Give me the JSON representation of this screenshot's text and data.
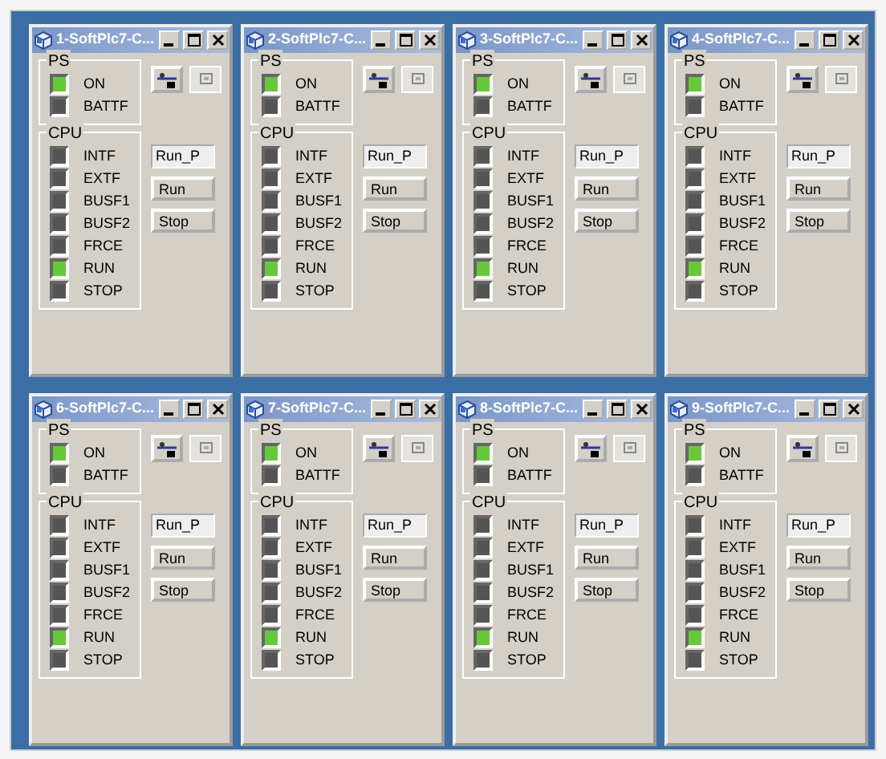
{
  "windows": [
    {
      "title": "1-SoftPlc7-C...",
      "ps": {
        "label": "PS",
        "leds": [
          {
            "label": "ON",
            "on": true
          },
          {
            "label": "BATTF",
            "on": false
          }
        ]
      },
      "cpu": {
        "label": "CPU",
        "leds": [
          {
            "label": "INTF",
            "on": false
          },
          {
            "label": "EXTF",
            "on": false
          },
          {
            "label": "BUSF1",
            "on": false
          },
          {
            "label": "BUSF2",
            "on": false
          },
          {
            "label": "FRCE",
            "on": false
          },
          {
            "label": "RUN",
            "on": true
          },
          {
            "label": "STOP",
            "on": false
          }
        ]
      },
      "mode": "Run_P",
      "buttons": [
        "Run",
        "Stop"
      ]
    },
    {
      "title": "2-SoftPlc7-C...",
      "ps": {
        "label": "PS",
        "leds": [
          {
            "label": "ON",
            "on": true
          },
          {
            "label": "BATTF",
            "on": false
          }
        ]
      },
      "cpu": {
        "label": "CPU",
        "leds": [
          {
            "label": "INTF",
            "on": false
          },
          {
            "label": "EXTF",
            "on": false
          },
          {
            "label": "BUSF1",
            "on": false
          },
          {
            "label": "BUSF2",
            "on": false
          },
          {
            "label": "FRCE",
            "on": false
          },
          {
            "label": "RUN",
            "on": true
          },
          {
            "label": "STOP",
            "on": false
          }
        ]
      },
      "mode": "Run_P",
      "buttons": [
        "Run",
        "Stop"
      ]
    },
    {
      "title": "3-SoftPlc7-C...",
      "ps": {
        "label": "PS",
        "leds": [
          {
            "label": "ON",
            "on": true
          },
          {
            "label": "BATTF",
            "on": false
          }
        ]
      },
      "cpu": {
        "label": "CPU",
        "leds": [
          {
            "label": "INTF",
            "on": false
          },
          {
            "label": "EXTF",
            "on": false
          },
          {
            "label": "BUSF1",
            "on": false
          },
          {
            "label": "BUSF2",
            "on": false
          },
          {
            "label": "FRCE",
            "on": false
          },
          {
            "label": "RUN",
            "on": true
          },
          {
            "label": "STOP",
            "on": false
          }
        ]
      },
      "mode": "Run_P",
      "buttons": [
        "Run",
        "Stop"
      ]
    },
    {
      "title": "4-SoftPlc7-C...",
      "ps": {
        "label": "PS",
        "leds": [
          {
            "label": "ON",
            "on": true
          },
          {
            "label": "BATTF",
            "on": false
          }
        ]
      },
      "cpu": {
        "label": "CPU",
        "leds": [
          {
            "label": "INTF",
            "on": false
          },
          {
            "label": "EXTF",
            "on": false
          },
          {
            "label": "BUSF1",
            "on": false
          },
          {
            "label": "BUSF2",
            "on": false
          },
          {
            "label": "FRCE",
            "on": false
          },
          {
            "label": "RUN",
            "on": true
          },
          {
            "label": "STOP",
            "on": false
          }
        ]
      },
      "mode": "Run_P",
      "buttons": [
        "Run",
        "Stop"
      ]
    },
    {
      "title": "6-SoftPlc7-C...",
      "ps": {
        "label": "PS",
        "leds": [
          {
            "label": "ON",
            "on": true
          },
          {
            "label": "BATTF",
            "on": false
          }
        ]
      },
      "cpu": {
        "label": "CPU",
        "leds": [
          {
            "label": "INTF",
            "on": false
          },
          {
            "label": "EXTF",
            "on": false
          },
          {
            "label": "BUSF1",
            "on": false
          },
          {
            "label": "BUSF2",
            "on": false
          },
          {
            "label": "FRCE",
            "on": false
          },
          {
            "label": "RUN",
            "on": true
          },
          {
            "label": "STOP",
            "on": false
          }
        ]
      },
      "mode": "Run_P",
      "buttons": [
        "Run",
        "Stop"
      ]
    },
    {
      "title": "7-SoftPlc7-C...",
      "ps": {
        "label": "PS",
        "leds": [
          {
            "label": "ON",
            "on": true
          },
          {
            "label": "BATTF",
            "on": false
          }
        ]
      },
      "cpu": {
        "label": "CPU",
        "leds": [
          {
            "label": "INTF",
            "on": false
          },
          {
            "label": "EXTF",
            "on": false
          },
          {
            "label": "BUSF1",
            "on": false
          },
          {
            "label": "BUSF2",
            "on": false
          },
          {
            "label": "FRCE",
            "on": false
          },
          {
            "label": "RUN",
            "on": true
          },
          {
            "label": "STOP",
            "on": false
          }
        ]
      },
      "mode": "Run_P",
      "buttons": [
        "Run",
        "Stop"
      ]
    },
    {
      "title": "8-SoftPlc7-C...",
      "ps": {
        "label": "PS",
        "leds": [
          {
            "label": "ON",
            "on": true
          },
          {
            "label": "BATTF",
            "on": false
          }
        ]
      },
      "cpu": {
        "label": "CPU",
        "leds": [
          {
            "label": "INTF",
            "on": false
          },
          {
            "label": "EXTF",
            "on": false
          },
          {
            "label": "BUSF1",
            "on": false
          },
          {
            "label": "BUSF2",
            "on": false
          },
          {
            "label": "FRCE",
            "on": false
          },
          {
            "label": "RUN",
            "on": true
          },
          {
            "label": "STOP",
            "on": false
          }
        ]
      },
      "mode": "Run_P",
      "buttons": [
        "Run",
        "Stop"
      ]
    },
    {
      "title": "9-SoftPlc7-C...",
      "ps": {
        "label": "PS",
        "leds": [
          {
            "label": "ON",
            "on": true
          },
          {
            "label": "BATTF",
            "on": false
          }
        ]
      },
      "cpu": {
        "label": "CPU",
        "leds": [
          {
            "label": "INTF",
            "on": false
          },
          {
            "label": "EXTF",
            "on": false
          },
          {
            "label": "BUSF1",
            "on": false
          },
          {
            "label": "BUSF2",
            "on": false
          },
          {
            "label": "FRCE",
            "on": false
          },
          {
            "label": "RUN",
            "on": true
          },
          {
            "label": "STOP",
            "on": false
          }
        ]
      },
      "mode": "Run_P",
      "buttons": [
        "Run",
        "Stop"
      ]
    }
  ]
}
